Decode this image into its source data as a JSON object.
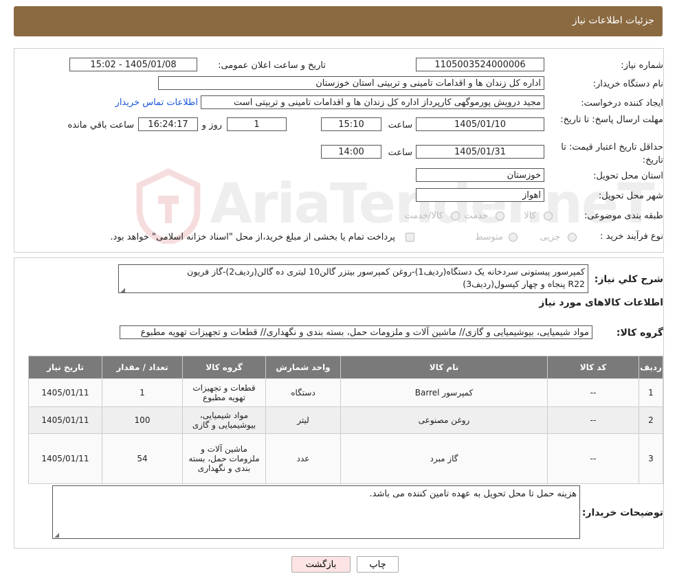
{
  "header": {
    "title": "جزئیات اطلاعات نیاز"
  },
  "form": {
    "need_number_label": "شماره نیاز:",
    "need_number": "1105003524000006",
    "announce_label": "تاریخ و ساعت اعلان عمومی:",
    "announce_value": "1405/01/08 - 15:02",
    "buyer_label": "نام دستگاه خریدار:",
    "buyer_value": "اداره کل زندان ها و اقدامات تامینی و تربیتی استان خوزستان",
    "creator_label": "ایجاد کننده درخواست:",
    "creator_value": "مجید درویش پورموگهی کارپرداز اداره کل زندان ها و اقدامات تامینی و تربیتی است",
    "contact_link": "اطلاعات تماس خریدار",
    "deadline_label": "مهلت ارسال پاسخ: تا تاریخ:",
    "deadline_date": "1405/01/10",
    "time_label": "ساعت",
    "deadline_time": "15:10",
    "days_value": "1",
    "days_label": "روز و",
    "remaining_value": "16:24:17",
    "remaining_label": "ساعت باقي مانده",
    "validity_label": "حداقل تاریخ اعتبار قیمت: تا تاریخ:",
    "validity_date": "1405/01/31",
    "validity_time": "14:00",
    "province_label": "استان محل تحویل:",
    "province_value": "خوزستان",
    "city_label": "شهر محل تحویل:",
    "city_value": "اهواز",
    "category_label": "طبقه بندی موضوعی:",
    "category_options": [
      "کالا",
      "خدمت",
      "کالا/خدمت"
    ],
    "process_label": "نوع فرآیند خرید :",
    "process_options": [
      "جزیی",
      "متوسط"
    ],
    "process_note": "پرداخت تمام یا بخشی از مبلغ خرید،از محل \"اسناد خزانه اسلامی\" خواهد بود."
  },
  "summary": {
    "label": "شرح كلي نياز:",
    "line1": "کمپرسور پیستونی سردخانه یک دستگاه(ردیف1)-روغن کمپرسور بیتزر گالن10 لیتری ده گالن(ردیف2)-گاز فریون",
    "line2": "R22 پنجاه و چهار کپسول(ردیف3)",
    "goods_title": "اطلاعات کالاهای مورد نیاز",
    "group_label": "گروه کالا:",
    "group_value": "مواد شیمیایی، بیوشیمیایی و  گازی// ماشین آلات و ملزومات حمل، بسته بندی و نگهداری//  قطعات و تجهیزات تهویه مطبوع"
  },
  "table": {
    "headers": [
      "ردیف",
      "کد کالا",
      "نام کالا",
      "واحد شمارش",
      "گروه کالا",
      "تعداد / مقدار",
      "تاریخ نیاز"
    ],
    "rows": [
      {
        "idx": "1",
        "code": "--",
        "name": "کمپرسور Barrel",
        "unit": "دستگاه",
        "group": "قطعات و تجهیزات تهویه مطبوع",
        "qty": "1",
        "date": "1405/01/11"
      },
      {
        "idx": "2",
        "code": "--",
        "name": "روغن مصنوعی",
        "unit": "لیتر",
        "group": "مواد شیمیایی، بیوشیمیایی و گازی",
        "qty": "100",
        "date": "1405/01/11"
      },
      {
        "idx": "3",
        "code": "--",
        "name": "گاز مبرد",
        "unit": "عدد",
        "group": "ماشین آلات و ملزومات حمل، بسته بندی و نگهداری",
        "qty": "54",
        "date": "1405/01/11"
      }
    ]
  },
  "buyer_notes": {
    "label": "توضیحات خریدار:",
    "text": "هزینه حمل تا محل تحویل به عهده تامین کننده می باشد."
  },
  "buttons": {
    "print": "چاپ",
    "back": "بازگشت"
  },
  "watermark": {
    "text": "AriaTender.neT"
  },
  "colors": {
    "header": "#8b6a42",
    "link": "#1a55d6",
    "table_header": "#7a7a7a",
    "back_button": "#fde4e4"
  }
}
